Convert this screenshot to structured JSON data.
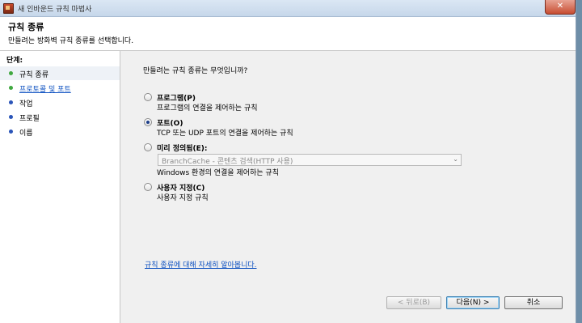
{
  "window": {
    "title": "새 인바운드 규칙 마법사",
    "close_label": "✕"
  },
  "header": {
    "title": "규칙 종류",
    "subtitle": "만들려는 방화벽 규칙 종류를 선택합니다."
  },
  "sidebar": {
    "heading": "단계:",
    "steps": [
      {
        "label": "규칙 종류",
        "status": "green"
      },
      {
        "label": "프로토콜 및 포트",
        "status": "green"
      },
      {
        "label": "작업",
        "status": "blue"
      },
      {
        "label": "프로필",
        "status": "blue"
      },
      {
        "label": "이름",
        "status": "blue"
      }
    ]
  },
  "main": {
    "question": "만들려는 규칙 종류는 무엇입니까?",
    "options": [
      {
        "label": "프로그램(P)",
        "desc": "프로그램의 연결을 제어하는 규칙",
        "checked": false
      },
      {
        "label": "포트(O)",
        "desc": "TCP 또는 UDP 포트의 연결을 제어하는 규칙",
        "checked": true
      },
      {
        "label": "미리 정의됨(E):",
        "desc": "Windows 환경의 연결을 제어하는 규칙",
        "checked": false
      },
      {
        "label": "사용자 지정(C)",
        "desc": "사용자 지정 규칙",
        "checked": false
      }
    ],
    "predefined_select": {
      "value": "BranchCache - 콘텐츠 검색(HTTP 사용)",
      "arrow": "⌄"
    },
    "help_link": "규칙 종류에 대해 자세히 알아봅니다."
  },
  "buttons": {
    "back": "< 뒤로(B)",
    "next": "다음(N) >",
    "cancel": "취소"
  },
  "colors": {
    "accent": "#0b4fc0",
    "step_done": "#3fa83f",
    "step_pending": "#2a54b8"
  }
}
